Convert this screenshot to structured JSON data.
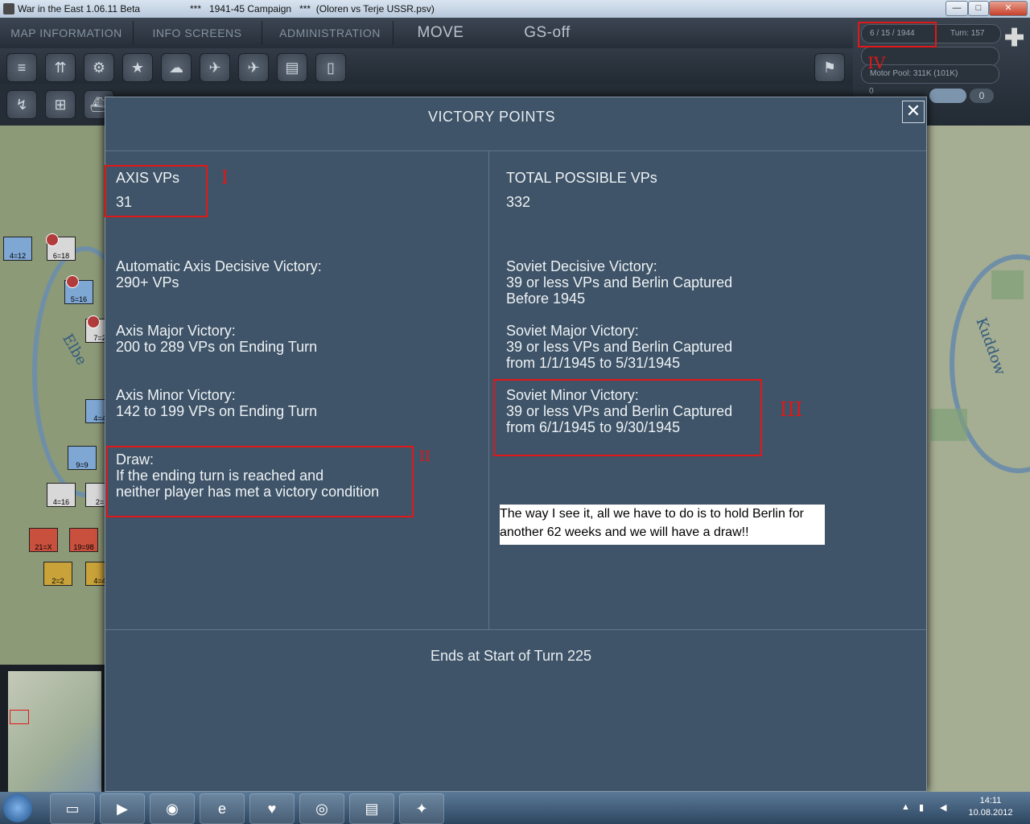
{
  "window": {
    "title": "War in the East 1.06.11 Beta",
    "subtitle": "***   1941-45 Campaign   ***  (Oloren vs Terje USSR.psv)",
    "minimize": "—",
    "maximize": "□",
    "close": "✕"
  },
  "topbar": {
    "tabs": [
      {
        "label": "MAP INFORMATION"
      },
      {
        "label": "INFO SCREENS"
      },
      {
        "label": "ADMINISTRATION"
      },
      {
        "label": "MOVE"
      },
      {
        "label": "GS-off"
      }
    ]
  },
  "status": {
    "date": "6 / 15 / 1944",
    "turn": "Turn: 157",
    "motor_pool": "Motor Pool:  311K (101K)",
    "small_value": "0",
    "count": "0"
  },
  "dialog": {
    "title": "VICTORY POINTS",
    "close": "✕",
    "axis_vps_label": "AXIS VPs",
    "axis_vps_value": "31",
    "total_vps_label": "TOTAL POSSIBLE VPs",
    "total_vps_value": "332",
    "axis_decisive": "Automatic Axis Decisive Victory:\n290+ VPs",
    "axis_major": "Axis Major Victory:\n200 to 289 VPs on Ending Turn",
    "axis_minor": "Axis Minor Victory:\n142 to 199 VPs on Ending Turn",
    "draw": "Draw:\nIf the ending turn is reached and\nneither player has met a victory condition",
    "soviet_decisive": "Soviet Decisive Victory:\n39 or less VPs and Berlin Captured\nBefore 1945",
    "soviet_major": "Soviet Major Victory:\n39 or less VPs and Berlin Captured\nfrom 1/1/1945 to 5/31/1945",
    "soviet_minor": "Soviet Minor Victory:\n39 or less VPs and Berlin Captured\nfrom 6/1/1945 to 9/30/1945",
    "footer": "Ends at Start of Turn 225",
    "note": "The way I see it, all we have to do is to hold Berlin for another 62 weeks and we will have a draw!!"
  },
  "annotations": {
    "one": "I",
    "two": "II",
    "three": "III",
    "four": "IV"
  },
  "map": {
    "river_label": "Elbe",
    "river_label_right": "Kuddow",
    "units": [
      {
        "label": "4=12"
      },
      {
        "label": "6=18"
      },
      {
        "label": "5=16"
      },
      {
        "label": "7=2"
      },
      {
        "label": "4=4"
      },
      {
        "label": "9=9"
      },
      {
        "label": "4=16"
      },
      {
        "label": "2="
      },
      {
        "label": "21=X"
      },
      {
        "label": "19=98"
      },
      {
        "label": "2=2"
      },
      {
        "label": "4=4"
      }
    ]
  },
  "taskbar": {
    "time": "14:11",
    "date": "10.08.2012"
  },
  "colors": {
    "annotation": "#e01818",
    "dialog_bg": "#3f5468",
    "note_bg": "#ffffff"
  }
}
